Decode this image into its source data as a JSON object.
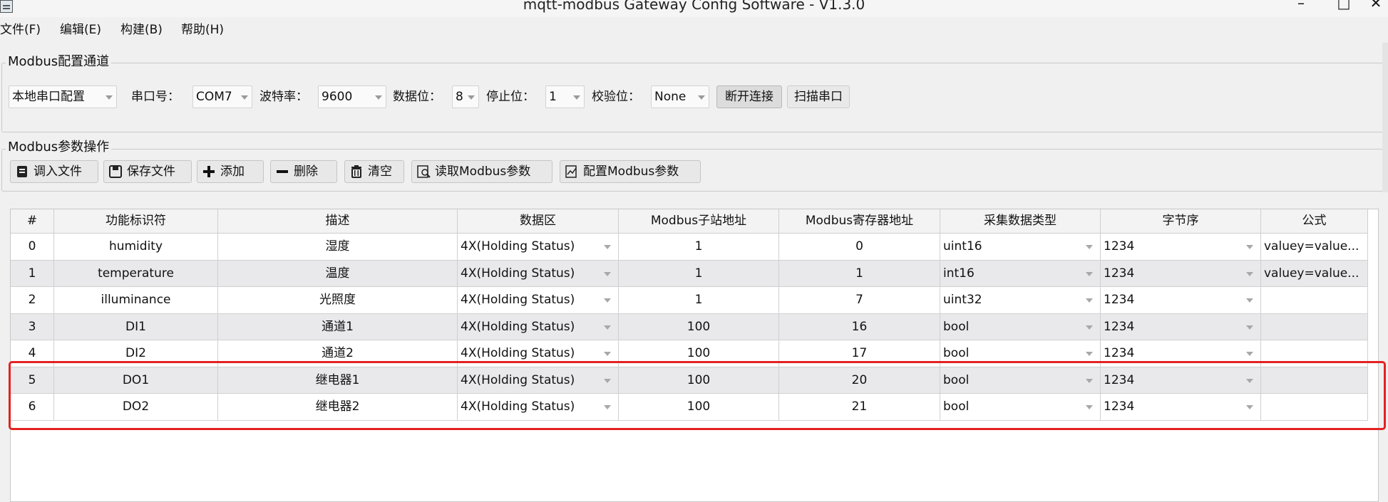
{
  "window": {
    "title": "mqtt-modbus Gateway Config Software - V1.3.0",
    "controls": [
      "–",
      "□",
      "✕"
    ]
  },
  "menu": [
    "文件(F)",
    "编辑(E)",
    "构建(B)",
    "帮助(H)"
  ],
  "channel": {
    "group_title": "Modbus配置通道",
    "mode": "本地串口配置",
    "port_label": "串口号：",
    "port_value": "COM7",
    "baud_label": "波特率：",
    "baud_value": "9600",
    "databits_label": "数据位：",
    "databits_value": "8",
    "stopbits_label": "停止位：",
    "stopbits_value": "1",
    "parity_label": "校验位：",
    "parity_value": "None",
    "disconnect_label": "断开连接",
    "scan_label": "扫描串口"
  },
  "ops": {
    "group_title": "Modbus参数操作",
    "buttons": [
      "调入文件",
      "保存文件",
      "添加",
      "删除",
      "清空",
      "读取Modbus参数",
      "配置Modbus参数"
    ]
  },
  "table": {
    "headers": [
      "#",
      "功能标识符",
      "描述",
      "数据区",
      "Modbus子站地址",
      "Modbus寄存器地址",
      "采集数据类型",
      "字节序",
      "公式"
    ],
    "rows": [
      [
        "0",
        "humidity",
        "湿度",
        "4X(Holding Status)",
        "1",
        "0",
        "uint16",
        "1234",
        "valuey=value..."
      ],
      [
        "1",
        "temperature",
        "温度",
        "4X(Holding Status)",
        "1",
        "1",
        "int16",
        "1234",
        "valuey=value..."
      ],
      [
        "2",
        "illuminance",
        "光照度",
        "4X(Holding Status)",
        "1",
        "7",
        "uint32",
        "1234",
        ""
      ],
      [
        "3",
        "DI1",
        "通道1",
        "4X(Holding Status)",
        "100",
        "16",
        "bool",
        "1234",
        ""
      ],
      [
        "4",
        "DI2",
        "通道2",
        "4X(Holding Status)",
        "100",
        "17",
        "bool",
        "1234",
        ""
      ],
      [
        "5",
        "DO1",
        "继电器1",
        "4X(Holding Status)",
        "100",
        "20",
        "bool",
        "1234",
        ""
      ],
      [
        "6",
        "DO2",
        "继电器2",
        "4X(Holding Status)",
        "100",
        "21",
        "bool",
        "1234",
        ""
      ]
    ]
  },
  "colors": {
    "highlight": "#e32222",
    "alt_row": "#e9e9ec"
  }
}
